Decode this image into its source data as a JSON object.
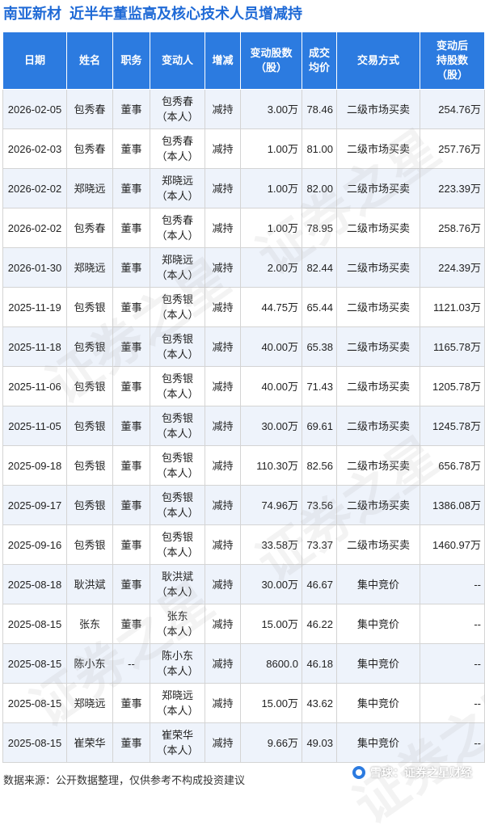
{
  "title": {
    "company": "南亚新材",
    "text": "近半年董监高及核心技术人员增减持"
  },
  "headers": [
    "日期",
    "姓名",
    "职务",
    "变动人",
    "增减",
    "变动股数\n（股）",
    "成交\n均价",
    "交易方式",
    "变动后\n持股数\n（股）"
  ],
  "rows": [
    [
      "2026-02-05",
      "包秀春",
      "董事",
      "包秀春\n（本人）",
      "减持",
      "3.00万",
      "78.46",
      "二级市场买卖",
      "254.76万"
    ],
    [
      "2026-02-03",
      "包秀春",
      "董事",
      "包秀春\n（本人）",
      "减持",
      "1.00万",
      "81.00",
      "二级市场买卖",
      "257.76万"
    ],
    [
      "2026-02-02",
      "郑晓远",
      "董事",
      "郑晓远\n（本人）",
      "减持",
      "1.00万",
      "82.00",
      "二级市场买卖",
      "223.39万"
    ],
    [
      "2026-02-02",
      "包秀春",
      "董事",
      "包秀春\n（本人）",
      "减持",
      "1.00万",
      "78.95",
      "二级市场买卖",
      "258.76万"
    ],
    [
      "2026-01-30",
      "郑晓远",
      "董事",
      "郑晓远\n（本人）",
      "减持",
      "2.00万",
      "82.44",
      "二级市场买卖",
      "224.39万"
    ],
    [
      "2025-11-19",
      "包秀银",
      "董事",
      "包秀银\n（本人）",
      "减持",
      "44.75万",
      "65.44",
      "二级市场买卖",
      "1121.03万"
    ],
    [
      "2025-11-18",
      "包秀银",
      "董事",
      "包秀银\n（本人）",
      "减持",
      "40.00万",
      "65.38",
      "二级市场买卖",
      "1165.78万"
    ],
    [
      "2025-11-06",
      "包秀银",
      "董事",
      "包秀银\n（本人）",
      "减持",
      "40.00万",
      "71.43",
      "二级市场买卖",
      "1205.78万"
    ],
    [
      "2025-11-05",
      "包秀银",
      "董事",
      "包秀银\n（本人）",
      "减持",
      "30.00万",
      "69.61",
      "二级市场买卖",
      "1245.78万"
    ],
    [
      "2025-09-18",
      "包秀银",
      "董事",
      "包秀银\n（本人）",
      "减持",
      "110.30万",
      "82.56",
      "二级市场买卖",
      "656.78万"
    ],
    [
      "2025-09-17",
      "包秀银",
      "董事",
      "包秀银\n（本人）",
      "减持",
      "74.96万",
      "73.56",
      "二级市场买卖",
      "1386.08万"
    ],
    [
      "2025-09-16",
      "包秀银",
      "董事",
      "包秀银\n（本人）",
      "减持",
      "33.58万",
      "73.37",
      "二级市场买卖",
      "1460.97万"
    ],
    [
      "2025-08-18",
      "耿洪斌",
      "董事",
      "耿洪斌\n（本人）",
      "减持",
      "30.00万",
      "46.67",
      "集中竞价",
      "--"
    ],
    [
      "2025-08-15",
      "张东",
      "董事",
      "张东\n（本人）",
      "减持",
      "15.00万",
      "46.22",
      "集中竞价",
      "--"
    ],
    [
      "2025-08-15",
      "陈小东",
      "--",
      "陈小东\n（本人）",
      "减持",
      "8600.0",
      "46.18",
      "集中竞价",
      "--"
    ],
    [
      "2025-08-15",
      "郑晓远",
      "董事",
      "郑晓远\n（本人）",
      "减持",
      "15.00万",
      "43.62",
      "集中竞价",
      "--"
    ],
    [
      "2025-08-15",
      "崔荣华",
      "董事",
      "崔荣华\n（本人）",
      "减持",
      "9.66万",
      "49.03",
      "集中竞价",
      "--"
    ]
  ],
  "footer": {
    "source": "数据来源：公开数据整理，仅供参考不构成投资建议",
    "brand": "雪球：证券之星财经"
  },
  "watermark_text": "证券之星",
  "colors": {
    "header_bg": "#2c7be0",
    "title": "#1f6ad6",
    "change_green": "#19a33f",
    "row_alt": "#eef3fb"
  }
}
